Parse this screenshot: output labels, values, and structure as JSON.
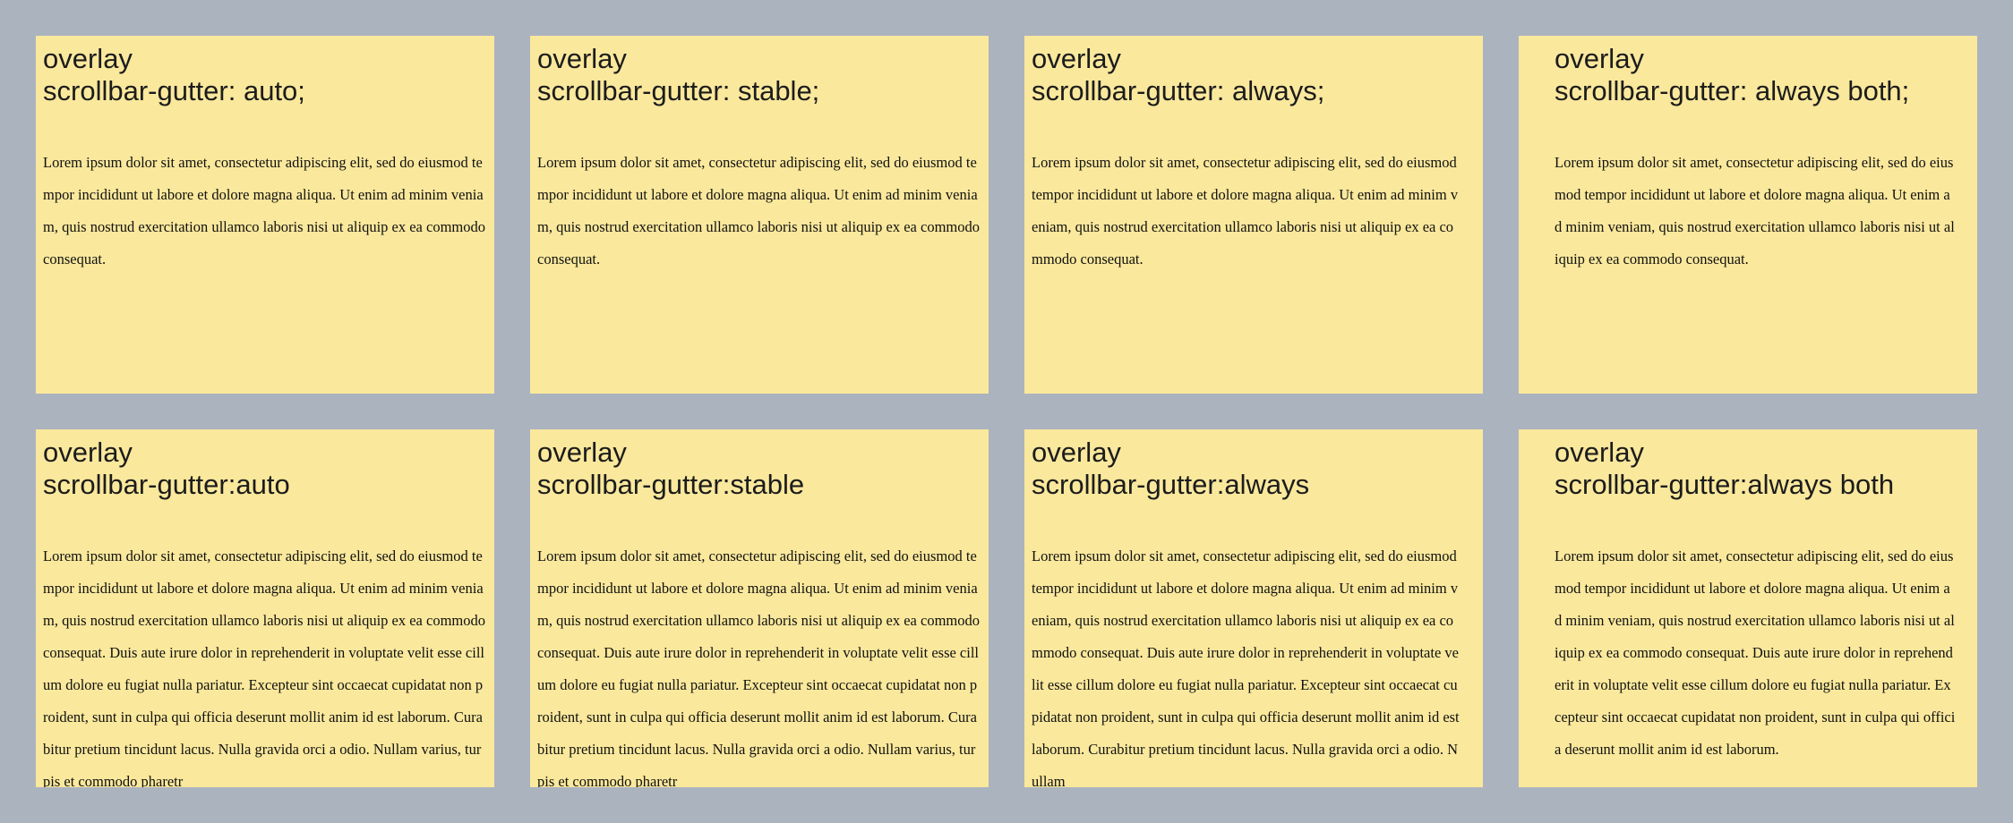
{
  "colors": {
    "page_background": "#abb3bf",
    "panel_background": "#fae89c",
    "text": "#1c1c1c"
  },
  "panels": [
    {
      "title_line1": "overlay",
      "title_line2": "scrollbar-gutter: auto;",
      "text": "Lorem ipsum dolor sit amet, consectetur adipiscing elit, sed do eiusmod tempor incididunt ut labore et dolore magna aliqua. Ut enim ad minim veniam, quis nostrud exercitation ullamco laboris nisi ut aliquip ex ea commodo consequat."
    },
    {
      "title_line1": "overlay",
      "title_line2": "scrollbar-gutter: stable;",
      "text": "Lorem ipsum dolor sit amet, consectetur adipiscing elit, sed do eiusmod tempor incididunt ut labore et dolore magna aliqua. Ut enim ad minim veniam, quis nostrud exercitation ullamco laboris nisi ut aliquip ex ea commodo consequat."
    },
    {
      "title_line1": "overlay",
      "title_line2": "scrollbar-gutter: always;",
      "text": "Lorem ipsum dolor sit amet, consectetur adipiscing elit, sed do eiusmod tempor incididunt ut labore et dolore magna aliqua. Ut enim ad minim veniam, quis nostrud exercitation ullamco laboris nisi ut aliquip ex ea commodo consequat."
    },
    {
      "title_line1": "overlay",
      "title_line2": "scrollbar-gutter: always both;",
      "text": "Lorem ipsum dolor sit amet, consectetur adipiscing elit, sed do eiusmod tempor incididunt ut labore et dolore magna aliqua. Ut enim ad minim veniam, quis nostrud exercitation ullamco laboris nisi ut aliquip ex ea commodo consequat."
    },
    {
      "title_line1": "overlay",
      "title_line2": "scrollbar-gutter:auto",
      "text": "Lorem ipsum dolor sit amet, consectetur adipiscing elit, sed do eiusmod tempor incididunt ut labore et dolore magna aliqua. Ut enim ad minim veniam, quis nostrud exercitation ullamco laboris nisi ut aliquip ex ea commodo consequat. Duis aute irure dolor in reprehenderit in voluptate velit esse cillum dolore eu fugiat nulla pariatur. Excepteur sint occaecat cupidatat non proident, sunt in culpa qui officia deserunt mollit anim id est laborum. Curabitur pretium tincidunt lacus. Nulla gravida orci a odio. Nullam varius, turpis et commodo pharetr"
    },
    {
      "title_line1": "overlay",
      "title_line2": "scrollbar-gutter:stable",
      "text": "Lorem ipsum dolor sit amet, consectetur adipiscing elit, sed do eiusmod tempor incididunt ut labore et dolore magna aliqua. Ut enim ad minim veniam, quis nostrud exercitation ullamco laboris nisi ut aliquip ex ea commodo consequat. Duis aute irure dolor in reprehenderit in voluptate velit esse cillum dolore eu fugiat nulla pariatur. Excepteur sint occaecat cupidatat non proident, sunt in culpa qui officia deserunt mollit anim id est laborum. Curabitur pretium tincidunt lacus. Nulla gravida orci a odio. Nullam varius, turpis et commodo pharetr"
    },
    {
      "title_line1": "overlay",
      "title_line2": "scrollbar-gutter:always",
      "text": "Lorem ipsum dolor sit amet, consectetur adipiscing elit, sed do eiusmod tempor incididunt ut labore et dolore magna aliqua. Ut enim ad minim veniam, quis nostrud exercitation ullamco laboris nisi ut aliquip ex ea commodo consequat. Duis aute irure dolor in reprehenderit in voluptate velit esse cillum dolore eu fugiat nulla pariatur. Excepteur sint occaecat cupidatat non proident, sunt in culpa qui officia deserunt mollit anim id est laborum. Curabitur pretium tincidunt lacus. Nulla gravida orci a odio. Nullam"
    },
    {
      "title_line1": "overlay",
      "title_line2": "scrollbar-gutter:always both",
      "text": "Lorem ipsum dolor sit amet, consectetur adipiscing elit, sed do eiusmod tempor incididunt ut labore et dolore magna aliqua. Ut enim ad minim veniam, quis nostrud exercitation ullamco laboris nisi ut aliquip ex ea commodo consequat. Duis aute irure dolor in reprehenderit in voluptate velit esse cillum dolore eu fugiat nulla pariatur. Excepteur sint occaecat cupidatat non proident, sunt in culpa qui officia deserunt mollit anim id est laborum."
    }
  ]
}
